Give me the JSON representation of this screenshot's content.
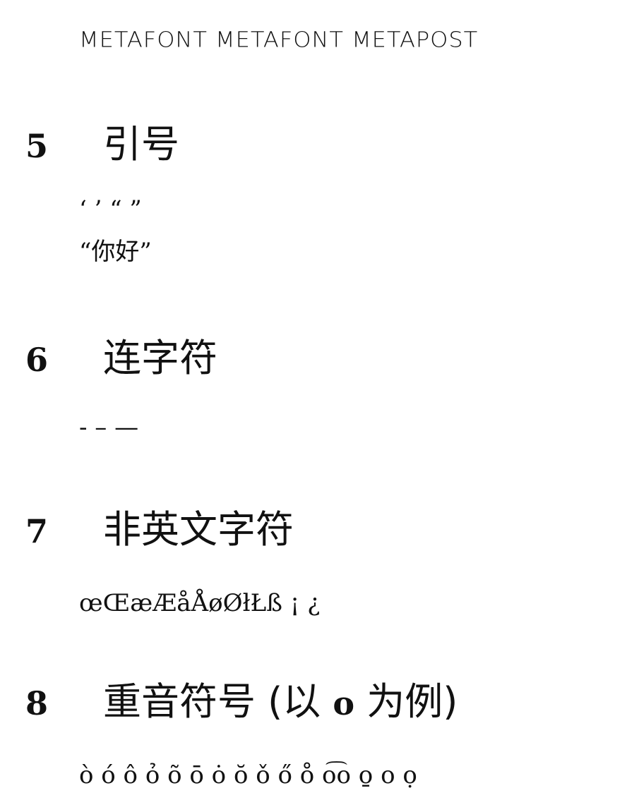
{
  "logo_line": "METAFONT METAFONT METAPOST",
  "sections": [
    {
      "number": "5",
      "title": "引号",
      "lines": [
        "‘ ’ “ ”",
        "“你好”"
      ]
    },
    {
      "number": "6",
      "title": "连字符",
      "lines": [
        "- – —"
      ]
    },
    {
      "number": "7",
      "title": "非英文字符",
      "lines": [
        "œŒæÆåÅøØłŁß ¡ ¿"
      ]
    },
    {
      "number": "8",
      "title_before": "重音符号 (以 ",
      "title_roman": "o",
      "title_after": " 为例)",
      "lines": [
        "ò ó ô ỏ õ ō ȯ ŏ ǒ ő o̊ o͡o o̱ o ọ"
      ]
    }
  ]
}
